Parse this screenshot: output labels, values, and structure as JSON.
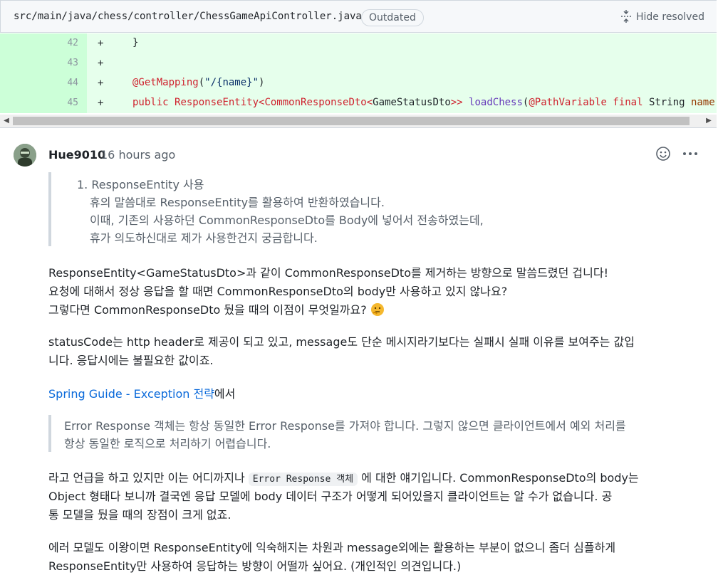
{
  "file": {
    "path": "src/main/java/chess/controller/ChessGameApiController.java",
    "badge": "Outdated",
    "hide_resolved": "Hide resolved"
  },
  "diff_lines": [
    {
      "number": "42",
      "sign": "+",
      "code": "}"
    },
    {
      "number": "43",
      "sign": "+",
      "code": ""
    },
    {
      "number": "44",
      "sign": "+",
      "code": "@GetMapping(\"/{name}\")"
    },
    {
      "number": "45",
      "sign": "+",
      "code": "public ResponseEntity<CommonResponseDto<GameStatusDto>> loadChess(@PathVariable final String name) {"
    }
  ],
  "comment": {
    "author": "Hue9010",
    "time": "16 hours ago",
    "quote1": [
      "1. ResponseEntity 사용",
      "휴의 말씀대로 ResponseEntity를 활용하여 반환하였습니다.",
      "이때, 기존의 사용하던 CommonResponseDto를 Body에 넣어서 전송하였는데,",
      "휴가 의도하신대로 제가 사용한건지 궁금합니다."
    ],
    "para1": [
      "ResponseEntity<GameStatusDto>과 같이 CommonResponseDto를 제거하는 방향으로 말씀드렸던 겁니다!",
      "요청에 대해서 정상 응답을 할 때면 CommonResponseDto의 body만 사용하고 있지 않나요?",
      "그렇다면 CommonResponseDto 뒀을 때의 이점이 무엇일까요? "
    ],
    "para2": [
      "statusCode는 http header로 제공이 되고 있고, message도 단순 메시지라기보다는 실패시 실패 이유를 보여주는 값입",
      "니다. 응답시에는 불필요한 값이죠."
    ],
    "link_text": "Spring Guide - Exception 전략",
    "link_suffix": "에서",
    "quote2": [
      "Error Response 객체는 항상 동일한 Error Response를 가져야 합니다. 그렇지 않으면 클라이언트에서 예외 처리를",
      "항상 동일한 로직으로 처리하기 어렵습니다."
    ],
    "para3_prefix": "라고 언급을 하고 있지만 이는 어디까지나 ",
    "para3_code": "Error Response 객체",
    "para3_suffix": " 에 대한 얘기입니다. CommonResponseDto의 body는",
    "para3_lines": [
      "Object 형태다 보니까 결국엔 응답 모델에 body 데이터 구조가 어떻게 되어있을지 클라이언트는 알 수가 없습니다. 공",
      "통 모델을 뒀을 때의 장점이 크게 없죠."
    ],
    "para4": [
      "에러 모델도 이왕이면 ResponseEntity에 익숙해지는 차원과 message외에는 활용하는 부분이 없으니 좀더 심플하게",
      "ResponseEntity만 사용하여 응답하는 방향이 어떨까 싶어요. (개인적인 의견입니다.)"
    ]
  }
}
